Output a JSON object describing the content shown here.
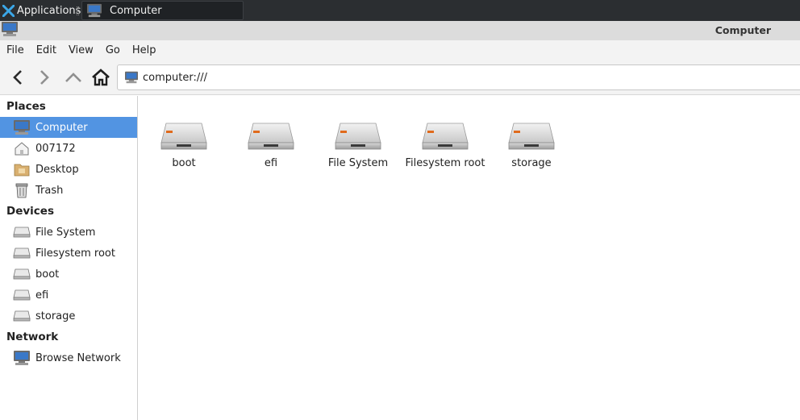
{
  "taskbar": {
    "apps_label": "Applications",
    "task_label": "Computer"
  },
  "window": {
    "title": "Computer"
  },
  "menu": [
    "File",
    "Edit",
    "View",
    "Go",
    "Help"
  ],
  "toolbar": {
    "location": "computer:///"
  },
  "sidebar": {
    "places_header": "Places",
    "places": [
      "Computer",
      "007172",
      "Desktop",
      "Trash"
    ],
    "devices_header": "Devices",
    "devices": [
      "File System",
      "Filesystem root",
      "boot",
      "efi",
      "storage"
    ],
    "network_header": "Network",
    "network": [
      "Browse Network"
    ]
  },
  "content": {
    "items": [
      "boot",
      "efi",
      "File System",
      "Filesystem root",
      "storage"
    ]
  },
  "colors": {
    "selection": "#5294e2",
    "taskbar": "#2b2e31",
    "drive_led": "#e06a1c"
  }
}
